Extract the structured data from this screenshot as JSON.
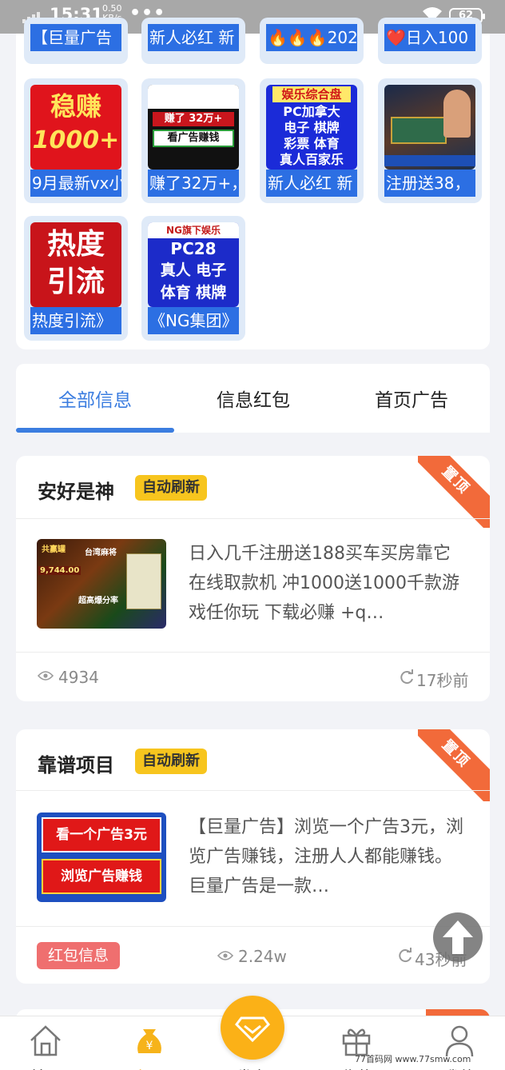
{
  "status_bar": {
    "time": "15:31",
    "speed_value": "0.50",
    "speed_unit": "KB/s",
    "more": "•••",
    "battery": "62"
  },
  "ad_grid": {
    "row1_captions": [
      "【巨量广告",
      "新人必红 新",
      "🔥🔥🔥202",
      "❤️日入100"
    ],
    "tiles": [
      {
        "caption": "9月最新vx小",
        "img_text": [
          "稳赚",
          "1000+"
        ]
      },
      {
        "caption": "赚了32万+，",
        "img_text": [
          "赚了 32万+",
          "看广告赚钱"
        ]
      },
      {
        "caption": "新人必红 新",
        "img_text": [
          "娱乐综合盘",
          "PC加拿大",
          "电子 棋牌",
          "彩票 体育",
          "真人百家乐"
        ]
      },
      {
        "caption": "注册送38，",
        "img_text": []
      },
      {
        "caption": "热度引流》",
        "img_text": [
          "热度",
          "引流"
        ]
      },
      {
        "caption": "《NG集团》",
        "img_text": [
          "NG旗下娱乐",
          "PC28",
          "真人 电子",
          "体育 棋牌"
        ]
      }
    ]
  },
  "tabs": [
    "全部信息",
    "信息红包",
    "首页广告"
  ],
  "posts": [
    {
      "title": "安好是神",
      "badge": "自动刷新",
      "corner": "置顶",
      "desc": "日入几千注册送188买车买房靠它 在线取款机 冲1000送1000千款游戏任你玩 下载必赚 +q…",
      "thumb_text": [
        "共赢罐",
        "台湾麻将",
        "9,744.00",
        "超高爆分率"
      ],
      "views": "4934",
      "time": "17秒前"
    },
    {
      "title": "靠谱项目",
      "badge": "自动刷新",
      "corner": "置顶",
      "desc": "【巨量广告】浏览一个广告3元，浏览广告赚钱，注册人人都能赚钱。巨量广告是一款…",
      "thumb_text": [
        "看一个广告3元",
        "浏览广告赚钱"
      ],
      "tag": "红包信息",
      "views": "2.24w",
      "time": "43秒前"
    }
  ],
  "bottom_nav": [
    "首页",
    "主页",
    "发布",
    "收藏",
    "我的"
  ],
  "watermark": "77首码网 www.77smw.com",
  "colors": {
    "accent": "#3b7de0",
    "badge": "#f7c51e",
    "corner": "#f26a3a",
    "tile_caption": "#2c6fe3",
    "center_button": "#fbb117",
    "red_tag": "#ef6f6f"
  }
}
